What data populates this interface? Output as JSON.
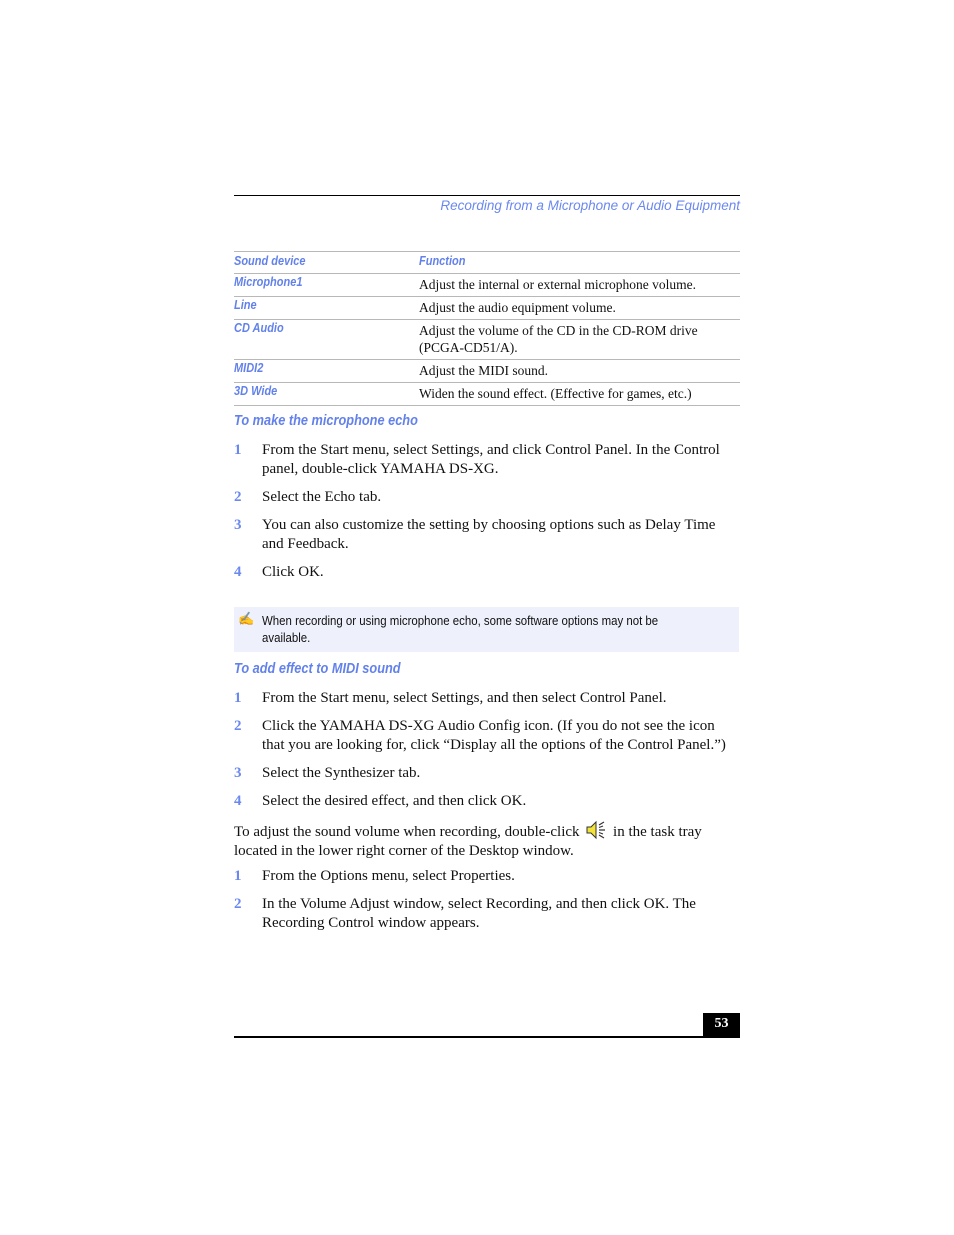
{
  "header": {
    "running_head": "Recording from a Microphone or Audio Equipment"
  },
  "table": {
    "columns": [
      "Sound device",
      "Function"
    ],
    "rows": [
      {
        "device": "Microphone1",
        "function": "Adjust the internal or external microphone volume."
      },
      {
        "device": "Line",
        "function": "Adjust the audio equipment volume."
      },
      {
        "device": "CD Audio",
        "function": "Adjust the volume of the CD in the CD-ROM drive (PCGA-CD51/A)."
      },
      {
        "device": "MIDI2",
        "function": "Adjust the MIDI sound."
      },
      {
        "device": "3D Wide",
        "function": "Widen the sound effect. (Effective for games, etc.)"
      }
    ]
  },
  "section_echo": {
    "heading": "To make the microphone echo",
    "steps": [
      {
        "num": "1",
        "text": "From the Start menu, select Settings, and click Control Panel. In the Control panel, double-click YAMAHA DS-XG."
      },
      {
        "num": "2",
        "text": "Select the Echo tab."
      },
      {
        "num": "3",
        "text": "You can also customize the setting by choosing options such as Delay Time and Feedback."
      },
      {
        "num": "4",
        "text": "Click OK."
      }
    ]
  },
  "note": {
    "icon": "pencil-note-icon",
    "glyph": "✍",
    "text": "When recording or using microphone echo, some software options may not be available."
  },
  "section_midi": {
    "heading": "To add effect to MIDI sound",
    "steps": [
      {
        "num": "1",
        "text": "From the Start menu, select Settings, and then select Control Panel."
      },
      {
        "num": "2",
        "text": "Click the YAMAHA DS-XG Audio Config icon. (If you do not see the icon that you are looking for, click “Display all the options of the Control Panel.”)"
      },
      {
        "num": "3",
        "text": "Select the Synthesizer tab."
      },
      {
        "num": "4",
        "text": "Select the desired effect, and then click OK."
      }
    ]
  },
  "volume_paragraph": {
    "before_icon": "To adjust the sound volume when recording, double-click",
    "icon": "speaker-volume-icon",
    "after_icon": "in the task tray located in the lower right corner of the Desktop window."
  },
  "section_volume": {
    "steps": [
      {
        "num": "1",
        "text": "From the Options menu, select Properties."
      },
      {
        "num": "2",
        "text": "In the Volume Adjust window, select Recording, and then click OK. The Recording Control window appears."
      }
    ]
  },
  "footer": {
    "page_number": "53"
  },
  "colors": {
    "accent": "#6281ea",
    "note_background": "#eef0fc"
  }
}
